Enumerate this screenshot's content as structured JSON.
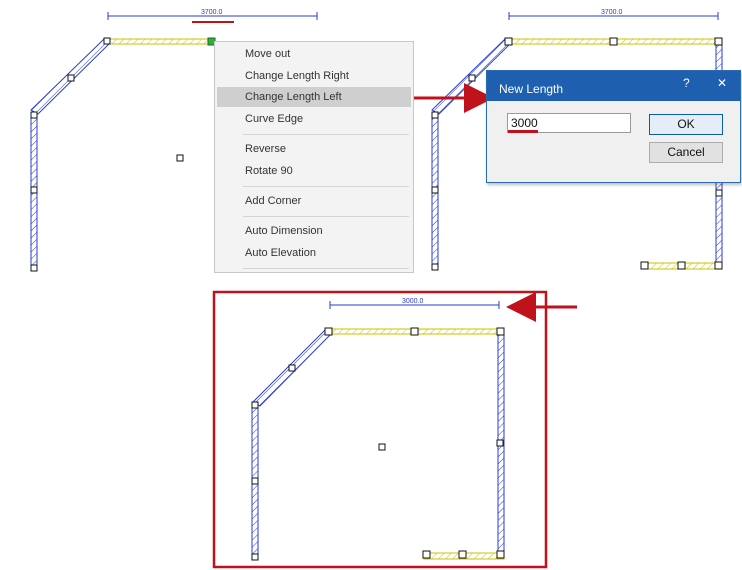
{
  "dimensions": {
    "left_panel": "3700.0",
    "right_panel": "3700.0",
    "result_panel": "3000.0"
  },
  "context_menu": {
    "items": [
      {
        "label": "Move out"
      },
      {
        "label": "Change Length Right"
      },
      {
        "label": "Change Length Left",
        "highlighted": true
      },
      {
        "label": "Curve Edge"
      },
      {
        "label": "Reverse"
      },
      {
        "label": "Rotate 90"
      },
      {
        "label": "Add Corner"
      },
      {
        "label": "Auto Dimension"
      },
      {
        "label": "Auto Elevation"
      }
    ]
  },
  "dialog": {
    "title": "New Length",
    "help_glyph": "?",
    "close_glyph": "✕",
    "input_value": "3000",
    "ok_label": "OK",
    "cancel_label": "Cancel"
  },
  "colors": {
    "accent_red": "#c0121b",
    "wall_blue": "#2a3bd6",
    "wall_yellow": "#d8d400",
    "dialog_title_bar": "#1f5fb0"
  },
  "icons": {
    "arrow_to_dialog": "arrow-right-icon",
    "arrow_to_result": "arrow-left-icon"
  }
}
